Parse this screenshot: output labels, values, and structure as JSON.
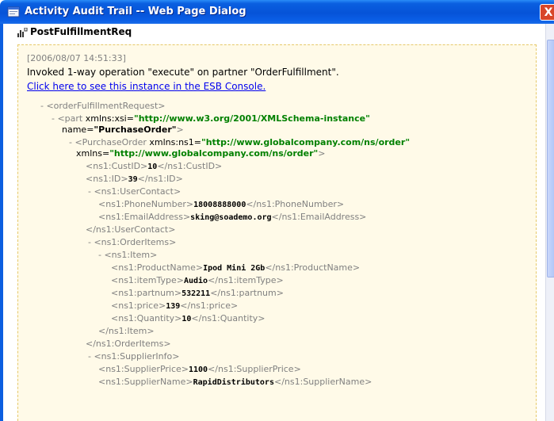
{
  "titlebar": {
    "title": "Activity Audit Trail -- Web Page Dialog",
    "close_glyph": "X"
  },
  "header": {
    "title": "PostFulfillmentReq"
  },
  "entry": {
    "timestamp": "[2006/08/07 14:51:33]",
    "message": "Invoked 1-way operation \"execute\" on partner \"OrderFulfillment\".",
    "link_text": "Click here to see this instance in the ESB Console."
  },
  "xml": {
    "l1": "- <orderFulfillmentRequest>",
    "l2a": "- <part ",
    "l2b": "xmlns:xsi=",
    "l2c": "\"http://www.w3.org/2001/XMLSchema-instance\"",
    "l3a": "name=",
    "l3b": "\"PurchaseOrder\"",
    "l3c": ">",
    "l4a": "- <PurchaseOrder ",
    "l4b": "xmlns:ns1=",
    "l4c": "\"http://www.globalcompany.com/ns/order\"",
    "l5a": "xmlns=",
    "l5b": "\"http://www.globalcompany.com/ns/order\"",
    "l5c": ">",
    "custid_open": "<ns1:CustID>",
    "custid_val": "10",
    "custid_close": "</ns1:CustID>",
    "id_open": "<ns1:ID>",
    "id_val": "39",
    "id_close": "</ns1:ID>",
    "usercontact_open": "- <ns1:UserContact>",
    "phone_open": "<ns1:PhoneNumber>",
    "phone_val": "18008888000",
    "phone_close": "</ns1:PhoneNumber>",
    "email_open": "<ns1:EmailAddress>",
    "email_val": "sking@soademo.org",
    "email_close": "</ns1:EmailAddress>",
    "usercontact_close": "</ns1:UserContact>",
    "orderitems_open": "- <ns1:OrderItems>",
    "item_open": "- <ns1:Item>",
    "pname_open": "<ns1:ProductName>",
    "pname_val": "Ipod Mini 2Gb",
    "pname_close": "</ns1:ProductName>",
    "itype_open": "<ns1:itemType>",
    "itype_val": "Audio",
    "itype_close": "</ns1:itemType>",
    "pnum_open": "<ns1:partnum>",
    "pnum_val": "532211",
    "pnum_close": "</ns1:partnum>",
    "price_open": "<ns1:price>",
    "price_val": "139",
    "price_close": "</ns1:price>",
    "qty_open": "<ns1:Quantity>",
    "qty_val": "10",
    "qty_close": "</ns1:Quantity>",
    "item_close": "</ns1:Item>",
    "orderitems_close": "</ns1:OrderItems>",
    "supplier_open": "- <ns1:SupplierInfo>",
    "sprice_open": "<ns1:SupplierPrice>",
    "sprice_val": "1100",
    "sprice_close": "</ns1:SupplierPrice>",
    "sname_open": "<ns1:SupplierName>",
    "sname_val": "RapidDistributors",
    "sname_close": "</ns1:SupplierName>"
  },
  "colors": {
    "titlebar": "#0653d8",
    "panel_bg": "#fffae8",
    "panel_border": "#e6c96a",
    "tag": "#808080",
    "attr_value": "#008000",
    "link": "#0000ee"
  }
}
